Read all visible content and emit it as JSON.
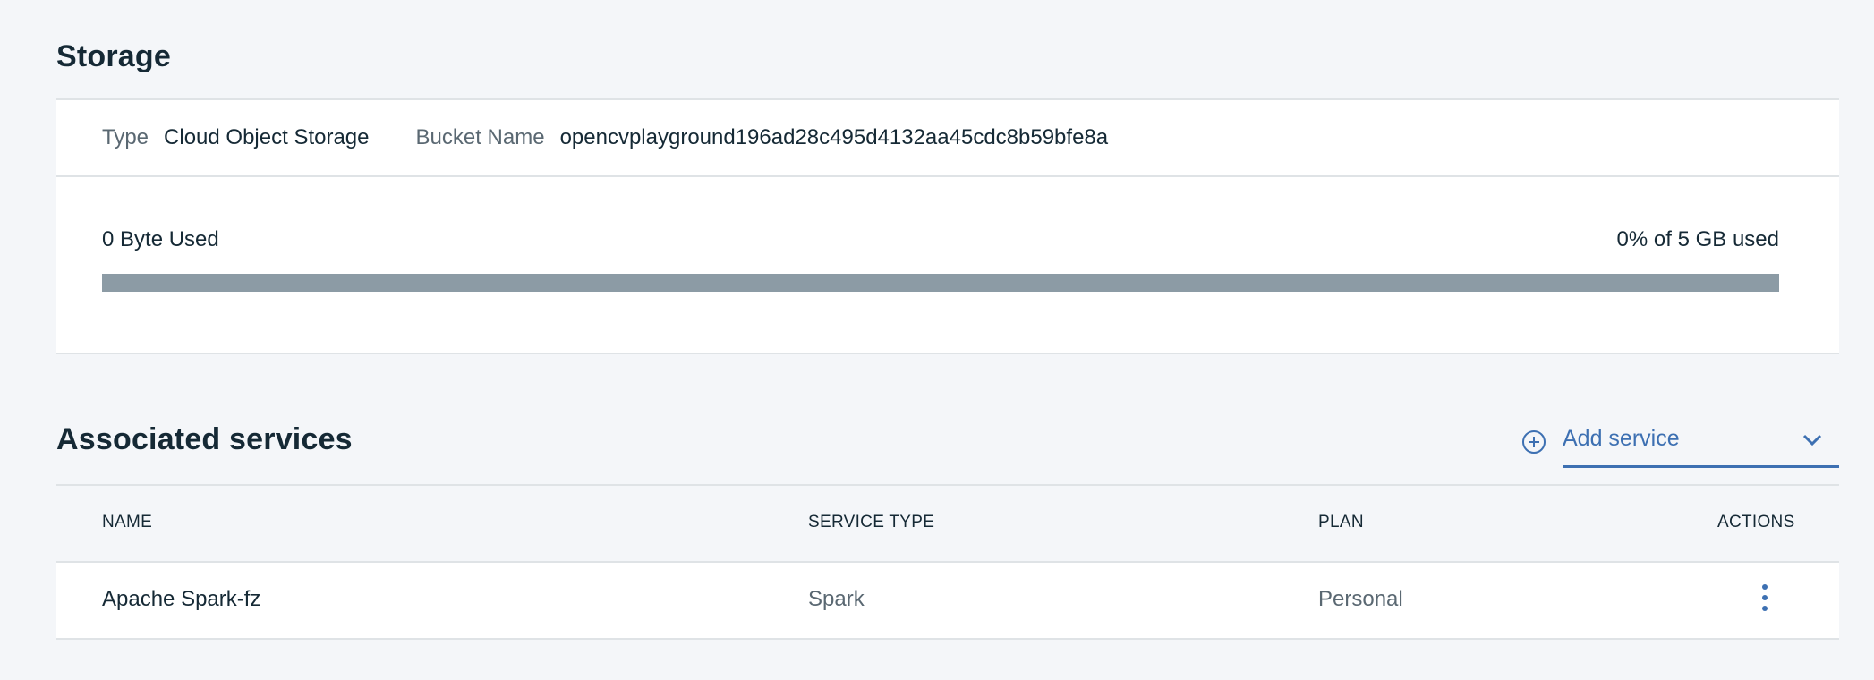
{
  "storage": {
    "title": "Storage",
    "type_label": "Type",
    "type_value": "Cloud Object Storage",
    "bucket_label": "Bucket Name",
    "bucket_value": "opencvplayground196ad28c495d4132aa45cdc8b59bfe8a",
    "used_text": "0 Byte Used",
    "quota_text": "0% of 5 GB used",
    "usage_percent": 0,
    "bar_color": "#8c9ba5"
  },
  "associated_services": {
    "title": "Associated services",
    "add_service_label": "Add service",
    "add_icon": "plus-circle-icon",
    "dropdown_icon": "chevron-down-icon",
    "accent_color": "#3d70b2",
    "columns": [
      "NAME",
      "SERVICE TYPE",
      "PLAN",
      "ACTIONS"
    ],
    "rows": [
      {
        "name": "Apache Spark-fz",
        "service_type": "Spark",
        "plan": "Personal",
        "actions_icon": "overflow-menu-vertical-icon"
      }
    ]
  }
}
